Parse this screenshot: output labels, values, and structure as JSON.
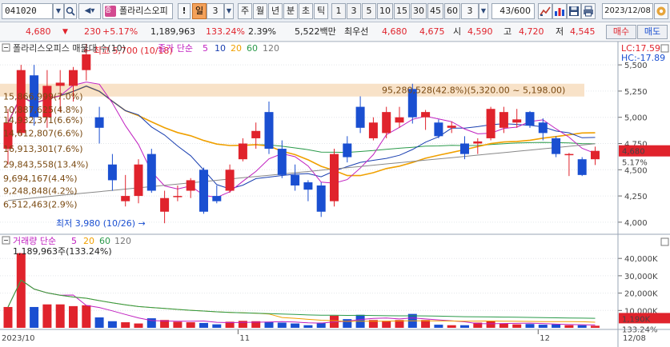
{
  "toolbar": {
    "stock_code": "041020",
    "stock_name": "폴라리스오피",
    "stock_badge": "종",
    "alert_label": "!",
    "period_selected": "일",
    "period_count": "3",
    "periods": [
      "주",
      "월",
      "년",
      "분",
      "초",
      "틱"
    ],
    "intervals": [
      "1",
      "3",
      "5",
      "10",
      "15",
      "30",
      "45",
      "60"
    ],
    "interval_count": "3",
    "bar_counter": "43/600",
    "date": "2023/12/08"
  },
  "quote": {
    "price": "4,680",
    "change_arrow": "▼",
    "change": "230",
    "change_pct": "+5.17%",
    "volume": "1,189,963",
    "volume_ratio": "133.24%",
    "turnover": "2.39%",
    "amount": "5,522백만",
    "best_ask_label": "최우선",
    "best_ask": "4,680",
    "best_bid": "4,675",
    "open_label": "시",
    "open": "4,590",
    "high_label": "고",
    "high": "4,720",
    "low_label": "저",
    "low": "4,545",
    "buy_button": "매수",
    "sell_button": "매도"
  },
  "chart_data": {
    "type": "candlestick",
    "title": "폴라리스오피스 매물대 수(10)",
    "ma_legend": {
      "label": "종가 단순",
      "periods": [
        "5",
        "10",
        "20",
        "60",
        "120"
      ],
      "colors": [
        "#c020c0",
        "#1a3fb0",
        "#f0a000",
        "#2a9a4a",
        "#777777"
      ]
    },
    "lc_label": "LC:17.59",
    "hc_label": "HC:-17.89",
    "price_axis": {
      "min": 3900,
      "max": 5600,
      "ticks": [
        4000,
        4250,
        4500,
        4750,
        5000,
        5250,
        5500
      ],
      "tick_labels": [
        "4,000",
        "4,250",
        "4,500",
        "4,750",
        "5,000",
        "5,250",
        "5,500"
      ]
    },
    "current_price_label": "4,680",
    "current_change_label": "5.17%",
    "high_annotation": "최고 5,700 (10/18)",
    "low_annotation": "최저 3,980 (10/26)",
    "volume_profile": [
      {
        "label": "15,866,999(7.0%)",
        "price": 5200
      },
      {
        "label": "10,887,625(4.8%)",
        "price": 5075
      },
      {
        "label": "14,932,371(6.6%)",
        "price": 4975
      },
      {
        "label": "14,612,807(6.6%)",
        "price": 4850
      },
      {
        "label": "16,913,301(7.6%)",
        "price": 4700
      },
      {
        "label": "29,843,558(13.4%)",
        "price": 4550
      },
      {
        "label": "9,694,167(4.4%)",
        "price": 4420
      },
      {
        "label": "9,248,848(4.2%)",
        "price": 4300
      },
      {
        "label": "6,512,463(2.9%)",
        "price": 4170
      }
    ],
    "max_volume_zone": {
      "label": "95,280,528(42.8%)(5,320.00 ~ 5,198.00)",
      "low": 5198,
      "high": 5320
    },
    "candles": [
      {
        "d": "10/04",
        "o": 4700,
        "h": 5080,
        "l": 4550,
        "c": 4950
      },
      {
        "d": "10/05",
        "o": 4850,
        "h": 5500,
        "l": 4830,
        "c": 5450
      },
      {
        "d": "10/06",
        "o": 5400,
        "h": 5500,
        "l": 4920,
        "c": 5000
      },
      {
        "d": "10/10",
        "o": 5000,
        "h": 5450,
        "l": 4900,
        "c": 5300
      },
      {
        "d": "10/11",
        "o": 5300,
        "h": 5450,
        "l": 5050,
        "c": 5330
      },
      {
        "d": "10/12",
        "o": 5300,
        "h": 5480,
        "l": 5150,
        "c": 5450
      },
      {
        "d": "10/13",
        "o": 5450,
        "h": 5700,
        "l": 5350,
        "c": 5600
      },
      {
        "d": "10/16",
        "o": 5000,
        "h": 5100,
        "l": 4750,
        "c": 4900
      },
      {
        "d": "10/17",
        "o": 4550,
        "h": 4650,
        "l": 4300,
        "c": 4400
      },
      {
        "d": "10/18",
        "o": 4200,
        "h": 4450,
        "l": 4150,
        "c": 4250
      },
      {
        "d": "10/19",
        "o": 4250,
        "h": 4600,
        "l": 4180,
        "c": 4550
      },
      {
        "d": "10/20",
        "o": 4650,
        "h": 4700,
        "l": 4280,
        "c": 4300
      },
      {
        "d": "10/23",
        "o": 4100,
        "h": 4300,
        "l": 3990,
        "c": 4230
      },
      {
        "d": "10/24",
        "o": 4250,
        "h": 4350,
        "l": 4200,
        "c": 4250
      },
      {
        "d": "10/25",
        "o": 4300,
        "h": 4420,
        "l": 4230,
        "c": 4400
      },
      {
        "d": "10/26",
        "o": 4500,
        "h": 4520,
        "l": 4080,
        "c": 4100
      },
      {
        "d": "10/27",
        "o": 4250,
        "h": 4350,
        "l": 4180,
        "c": 4200
      },
      {
        "d": "10/30",
        "o": 4300,
        "h": 4550,
        "l": 4280,
        "c": 4500
      },
      {
        "d": "10/31",
        "o": 4600,
        "h": 4800,
        "l": 4580,
        "c": 4750
      },
      {
        "d": "11/01",
        "o": 4800,
        "h": 4950,
        "l": 4700,
        "c": 4870
      },
      {
        "d": "11/02",
        "o": 5050,
        "h": 5150,
        "l": 4650,
        "c": 4700
      },
      {
        "d": "11/03",
        "o": 4700,
        "h": 4780,
        "l": 4420,
        "c": 4450
      },
      {
        "d": "11/06",
        "o": 4450,
        "h": 4550,
        "l": 4300,
        "c": 4350
      },
      {
        "d": "11/07",
        "o": 4380,
        "h": 4400,
        "l": 4200,
        "c": 4310
      },
      {
        "d": "11/08",
        "o": 4350,
        "h": 4380,
        "l": 4050,
        "c": 4100
      },
      {
        "d": "11/09",
        "o": 4200,
        "h": 4700,
        "l": 4150,
        "c": 4650
      },
      {
        "d": "11/10",
        "o": 4750,
        "h": 4820,
        "l": 4570,
        "c": 4620
      },
      {
        "d": "11/13",
        "o": 5100,
        "h": 5200,
        "l": 4850,
        "c": 4900
      },
      {
        "d": "11/14",
        "o": 4800,
        "h": 5000,
        "l": 4780,
        "c": 4950
      },
      {
        "d": "11/15",
        "o": 4850,
        "h": 5100,
        "l": 4800,
        "c": 5050
      },
      {
        "d": "11/16",
        "o": 4950,
        "h": 5100,
        "l": 4900,
        "c": 5000
      },
      {
        "d": "11/17",
        "o": 5270,
        "h": 5320,
        "l": 4940,
        "c": 5000
      },
      {
        "d": "11/20",
        "o": 5000,
        "h": 5070,
        "l": 4880,
        "c": 5050
      },
      {
        "d": "11/21",
        "o": 4950,
        "h": 4980,
        "l": 4800,
        "c": 4820
      },
      {
        "d": "11/22",
        "o": 4900,
        "h": 4960,
        "l": 4850,
        "c": 4920
      },
      {
        "d": "11/23",
        "o": 4750,
        "h": 4820,
        "l": 4600,
        "c": 4650
      },
      {
        "d": "11/24",
        "o": 4750,
        "h": 4800,
        "l": 4650,
        "c": 4770
      },
      {
        "d": "11/27",
        "o": 4800,
        "h": 5100,
        "l": 4780,
        "c": 5080
      },
      {
        "d": "11/28",
        "o": 4900,
        "h": 5100,
        "l": 4850,
        "c": 5050
      },
      {
        "d": "11/29",
        "o": 4950,
        "h": 5080,
        "l": 4900,
        "c": 4980
      },
      {
        "d": "11/30",
        "o": 5050,
        "h": 5060,
        "l": 4900,
        "c": 4920
      },
      {
        "d": "12/01",
        "o": 4950,
        "h": 4990,
        "l": 4780,
        "c": 4850
      },
      {
        "d": "12/04",
        "o": 4800,
        "h": 4820,
        "l": 4620,
        "c": 4650
      },
      {
        "d": "12/05",
        "o": 4650,
        "h": 4660,
        "l": 4440,
        "c": 4650
      },
      {
        "d": "12/06",
        "o": 4600,
        "h": 4620,
        "l": 4440,
        "c": 4450
      },
      {
        "d": "12/07",
        "o": 4600,
        "h": 4720,
        "l": 4545,
        "c": 4680
      }
    ],
    "volume_panel": {
      "label": "거래량 단순",
      "periods": [
        "5",
        "20",
        "60",
        "120"
      ],
      "current_label": "1,189,963주(133.24%)",
      "axis_ticks": [
        10000,
        20000,
        30000,
        40000
      ],
      "axis_tick_labels": [
        "10,000K",
        "20,000K",
        "30,000K",
        "40,000K"
      ],
      "axis_max": 47000,
      "current_volume_label": "1,190K",
      "current_ratio_label": "133.24%",
      "volumes": [
        12000,
        43000,
        12000,
        13500,
        13500,
        12500,
        13000,
        6000,
        3800,
        3200,
        2500,
        5500,
        4500,
        3500,
        3200,
        2800,
        2000,
        3500,
        4000,
        3800,
        3500,
        3000,
        2500,
        1500,
        3000,
        7000,
        5000,
        7500,
        4500,
        4000,
        4500,
        8000,
        4500,
        1800,
        1500,
        1500,
        3000,
        4000,
        2500,
        2000,
        2200,
        1800,
        2000,
        1500,
        1500,
        1190
      ]
    },
    "date_labels": [
      {
        "label": "2023/10",
        "index": 0
      },
      {
        "label": "11",
        "index": 18
      },
      {
        "label": "12",
        "index": 41
      },
      {
        "label": "12/08",
        "index": 45
      }
    ],
    "colors": {
      "up": "#e0232c",
      "down": "#1a4fd1",
      "zone": "#f8e2c8"
    }
  }
}
